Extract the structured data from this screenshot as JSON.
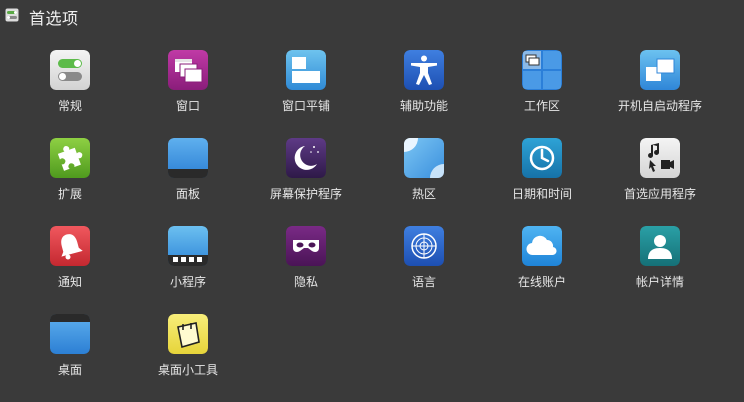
{
  "window": {
    "title": "首选项",
    "icon": "preferences-app-icon"
  },
  "items": [
    {
      "id": "general",
      "label": "常规",
      "icon": "toggle-switches-icon"
    },
    {
      "id": "windows",
      "label": "窗口",
      "icon": "windows-stack-icon"
    },
    {
      "id": "tiling",
      "label": "窗口平铺",
      "icon": "window-tiling-icon"
    },
    {
      "id": "accessibility",
      "label": "辅助功能",
      "icon": "accessibility-person-icon"
    },
    {
      "id": "workspaces",
      "label": "工作区",
      "icon": "workspaces-grid-icon"
    },
    {
      "id": "startup",
      "label": "开机自启动程序",
      "icon": "startup-windows-icon"
    },
    {
      "id": "extensions",
      "label": "扩展",
      "icon": "puzzle-piece-icon"
    },
    {
      "id": "panel",
      "label": "面板",
      "icon": "panel-bar-icon"
    },
    {
      "id": "screensaver",
      "label": "屏幕保护程序",
      "icon": "moon-stars-icon"
    },
    {
      "id": "hotcorners",
      "label": "热区",
      "icon": "hot-corner-icon"
    },
    {
      "id": "datetime",
      "label": "日期和时间",
      "icon": "clock-icon"
    },
    {
      "id": "default-apps",
      "label": "首选应用程序",
      "icon": "music-video-file-icon"
    },
    {
      "id": "notifications",
      "label": "通知",
      "icon": "bell-icon"
    },
    {
      "id": "applets",
      "label": "小程序",
      "icon": "applets-panel-icon"
    },
    {
      "id": "privacy",
      "label": "隐私",
      "icon": "privacy-mask-icon"
    },
    {
      "id": "languages",
      "label": "语言",
      "icon": "globe-un-icon"
    },
    {
      "id": "online-accounts",
      "label": "在线账户",
      "icon": "cloud-icon"
    },
    {
      "id": "account-details",
      "label": "帐户详情",
      "icon": "user-account-icon"
    },
    {
      "id": "desktop",
      "label": "桌面",
      "icon": "desktop-screen-icon"
    },
    {
      "id": "desklets",
      "label": "桌面小工具",
      "icon": "sticky-note-icon"
    }
  ]
}
